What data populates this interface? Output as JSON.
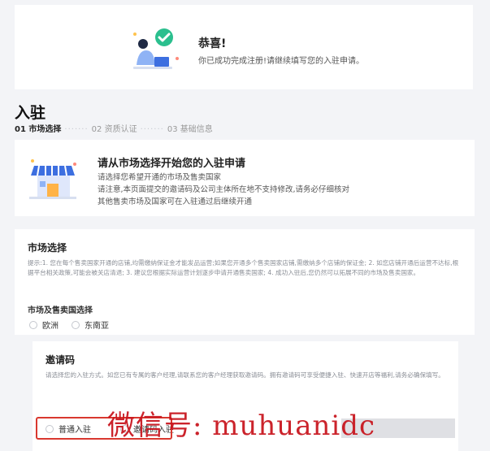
{
  "banner": {
    "title": "恭喜!",
    "subtitle": "你已成功完成注册!请继续填写您的入驻申请。"
  },
  "page": {
    "title": "入驻",
    "steps": [
      "01 市场选择",
      "02 资质认证",
      "03 基础信息"
    ],
    "active_step": 0
  },
  "intro": {
    "title": "请从市场选择开始您的入驻申请",
    "lines": [
      "请选择您希望开通的市场及售卖国家",
      "请注意,本页面提交的邀请码及公司主体所在地不支持修改,请务必仔细核对",
      "其他售卖市场及国家可在入驻通过后继续开通"
    ]
  },
  "market": {
    "title": "市场选择",
    "tip": "提示:1. 您在每个售卖国家开通的店铺,均需缴纳保证金才能发品运营;如果您开通多个售卖国家店铺,需缴纳多个店铺的保证金; 2. 如您店铺开通后运营不达标,根据平台相关政策,可能会被关店清退; 3. 建议您根据实际运营计划逐步申请开通售卖国家; 4. 成功入驻后,您仍然可以拓展不同的市场及售卖国家。",
    "region_label": "市场及售卖国选择",
    "options": [
      "欧洲",
      "东南亚"
    ]
  },
  "invite": {
    "title": "邀请码",
    "desc": "请选择您的入驻方式。如您已有专属的客户经理,请联系您的客户经理获取邀请码。拥有邀请码可享受便捷入驻、快速开店等福利,请务必确保填写。",
    "options": [
      "普通入驻",
      "邀请码入驻"
    ]
  },
  "watermark": "微信号: muhuanidc",
  "colors": {
    "accent_green": "#2bbf8e",
    "highlight_red": "#d9382f",
    "watermark_red": "#c8131b",
    "store_blue": "#3d6fe0"
  }
}
